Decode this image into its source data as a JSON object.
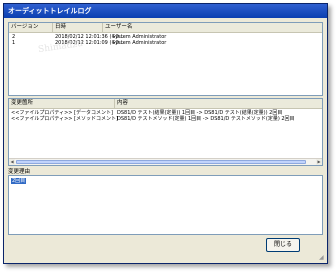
{
  "window": {
    "title": "オーディットトレイルログ"
  },
  "audit_table": {
    "columns": [
      "バージョン",
      "日時",
      "ユーザー名"
    ],
    "rows": [
      {
        "version": "2",
        "datetime": "2018/02/12 12:01:36 (+0...",
        "user": "System Administrator"
      },
      {
        "version": "1",
        "datetime": "2018/02/12 12:01:09 (+0...",
        "user": "System Administrator"
      }
    ]
  },
  "changes_table": {
    "columns": [
      "変更箇所",
      "内容"
    ],
    "rows": [
      {
        "location": "<<ファイルプロパティ>> [データコメント]",
        "content": "DS81/D テスト(結果(定量)) 1回目 -> DS81/D テスト(結果(定量)) 2回目"
      },
      {
        "location": "<<ファイルプロパティ>> [メソッドコメント]",
        "content": "DS81/D テストメソッド(定量) 1回目 -> DS81/D テストメソッド(定量) 2回目"
      }
    ]
  },
  "reason": {
    "label": "変更理由",
    "value": "2回目"
  },
  "close_button": {
    "label": "閉じる"
  },
  "watermark": "Shimadzu"
}
